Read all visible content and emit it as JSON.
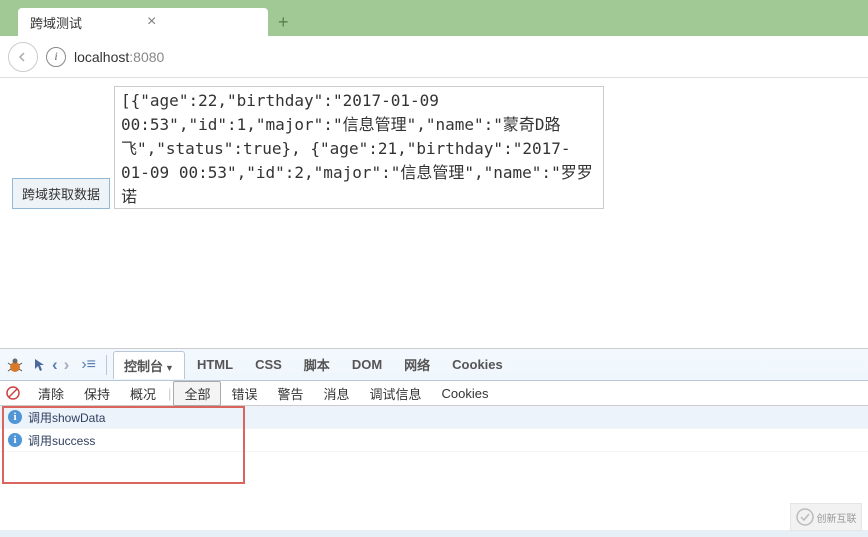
{
  "browser": {
    "tab_title": "跨域测试",
    "url_host": "localhost",
    "url_port": ":8080"
  },
  "page": {
    "button_label": "跨域获取数据",
    "data_content": "[{\"age\":22,\"birthday\":\"2017-01-09 00:53\",\"id\":1,\"major\":\"信息管理\",\"name\":\"蒙奇D路飞\",\"status\":true},\n{\"age\":21,\"birthday\":\"2017-01-09 00:53\",\"id\":2,\"major\":\"信息管理\",\"name\":\"罗罗诺"
  },
  "devtools": {
    "tabs": {
      "console": "控制台",
      "html": "HTML",
      "css": "CSS",
      "script": "脚本",
      "dom": "DOM",
      "network": "网络",
      "cookies": "Cookies"
    },
    "subbar": {
      "clear": "清除",
      "persist": "保持",
      "profile": "概况",
      "all": "全部",
      "error": "错误",
      "warn": "警告",
      "info": "消息",
      "debug": "调试信息",
      "cookies": "Cookies"
    },
    "console_rows": [
      "调用showData",
      "调用success"
    ]
  },
  "watermark": {
    "text": "创新互联"
  }
}
